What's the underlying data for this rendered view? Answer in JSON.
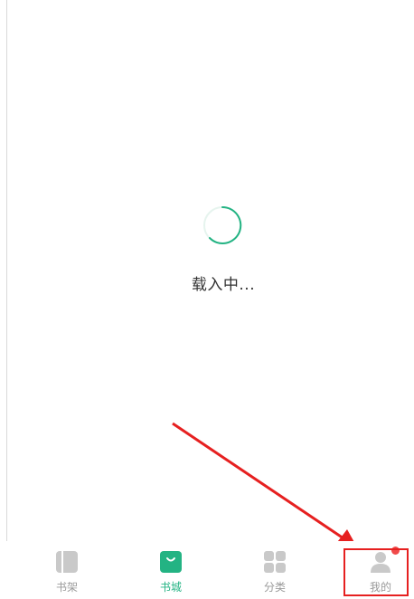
{
  "loading": {
    "text": "载入中..."
  },
  "tabbar": {
    "items": [
      {
        "label": "书架",
        "icon": "bookshelf-icon",
        "active": false
      },
      {
        "label": "书城",
        "icon": "bookstore-bag-icon",
        "active": true
      },
      {
        "label": "分类",
        "icon": "category-grid-icon",
        "active": false
      },
      {
        "label": "我的",
        "icon": "profile-icon",
        "active": false
      }
    ]
  },
  "colors": {
    "accent": "#23b383",
    "inactive": "#9a9a9a",
    "annotation": "#e62020"
  }
}
